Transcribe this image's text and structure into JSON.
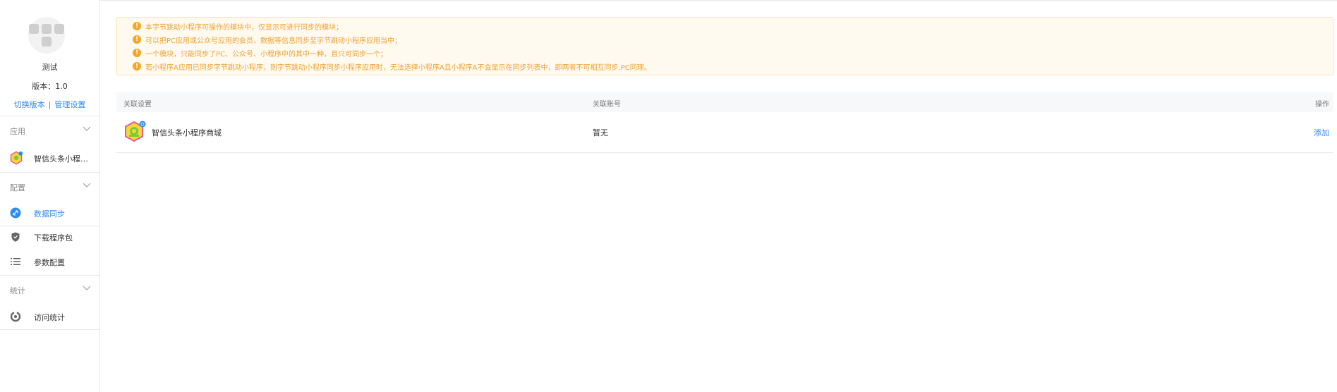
{
  "app": {
    "name": "测试",
    "version": "版本：1.0",
    "switch_version": "切换版本",
    "separator": "|",
    "manage_settings": "管理设置"
  },
  "sidebar": {
    "groups": [
      {
        "label": "应用",
        "items": [
          {
            "label": "智信头条小程序...",
            "icon": "toutiao-app-icon"
          }
        ]
      },
      {
        "label": "配置",
        "items": [
          {
            "label": "数据同步",
            "icon": "link-icon",
            "active": true
          },
          {
            "label": "下载程序包",
            "icon": "shield-icon"
          },
          {
            "label": "参数配置",
            "icon": "list-icon"
          }
        ]
      },
      {
        "label": "统计",
        "items": [
          {
            "label": "访问统计",
            "icon": "stats-icon"
          }
        ]
      }
    ]
  },
  "notice": {
    "lines": [
      "本字节跳动小程序可操作的模块中，仅显示可进行同步的模块；",
      "可以把PC应用或公众号应用的会员、数据等信息同步至字节跳动小程序应用当中；",
      "一个模块，只能同步了PC、公众号、小程序中的其中一种，且只可同步一个；",
      "若小程序A应用已同步字节跳动小程序，则字节跳动小程序同步小程序应用时，无法选择小程序A且小程序A不会显示在同步列表中，即两者不可相互同步,PC同理。"
    ]
  },
  "table": {
    "headers": {
      "setting": "关联设置",
      "account": "关联账号",
      "action": "操作"
    },
    "rows": [
      {
        "setting": "智信头条小程序商城",
        "account": "暂无",
        "action": "添加"
      }
    ]
  },
  "colors": {
    "accent": "#2d8cf0",
    "warning": "#f5a623",
    "notice_bg": "#fffaf0"
  }
}
